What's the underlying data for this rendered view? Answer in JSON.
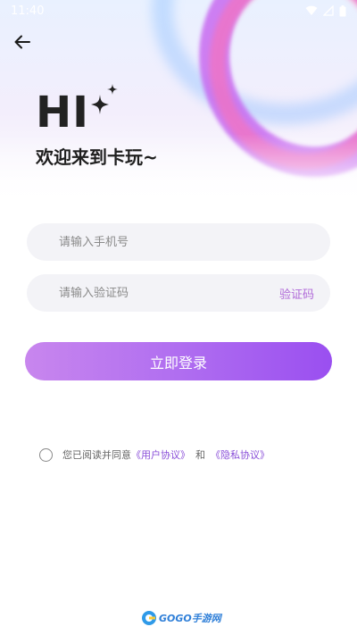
{
  "status_bar": {
    "time": "11:40"
  },
  "header": {
    "hi_text": "HI",
    "welcome_text": "欢迎来到卡玩~"
  },
  "form": {
    "phone_placeholder": "请输入手机号",
    "code_placeholder": "请输入验证码",
    "get_code_label": "验证码",
    "login_label": "立即登录"
  },
  "agreement": {
    "prefix": "您已阅读并同意",
    "user_agreement": "《用户协议》",
    "conjunction": "和",
    "privacy_policy": "《隐私协议》"
  },
  "watermark": {
    "text": "GOGO手游网"
  },
  "colors": {
    "accent": "#9a4ff0",
    "link": "#8a4fd8",
    "code_button": "#b06ad8"
  }
}
